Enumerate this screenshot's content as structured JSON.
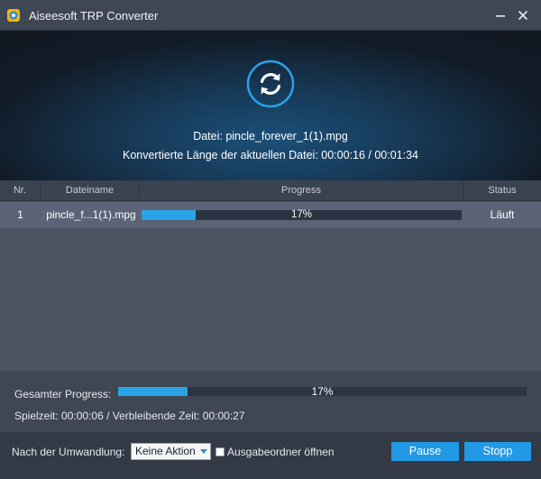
{
  "window": {
    "title": "Aiseesoft TRP Converter",
    "logo_icon": "aiseesoft-logo-icon",
    "minimize_icon": "minimize-icon",
    "close_icon": "close-icon"
  },
  "hero": {
    "icon": "convert-refresh-icon",
    "accent_color": "#2aa3e6",
    "file_line": "Datei: pincle_forever_1(1).mpg",
    "length_line": "Konvertierte Länge der aktuellen Datei: 00:00:16 / 00:01:34"
  },
  "table": {
    "columns": [
      "Nr.",
      "Dateiname",
      "Progress",
      "Status"
    ],
    "rows": [
      {
        "nr": "1",
        "filename": "pincle_f...1(1).mpg",
        "progress": 17,
        "progress_label": "17%",
        "status": "Läuft"
      }
    ]
  },
  "overall": {
    "label": "Gesamter Progress:",
    "progress": 17,
    "progress_label": "17%",
    "times": "Spielzeit: 00:00:06 / Verbleibende Zeit: 00:00:27"
  },
  "footer": {
    "after_label": "Nach der Umwandlung:",
    "after_select_value": "Keine Aktion",
    "open_folder_label": "Ausgabeordner öffnen",
    "open_folder_checked": false,
    "pause_label": "Pause",
    "stop_label": "Stopp",
    "button_color": "#2299e4"
  }
}
